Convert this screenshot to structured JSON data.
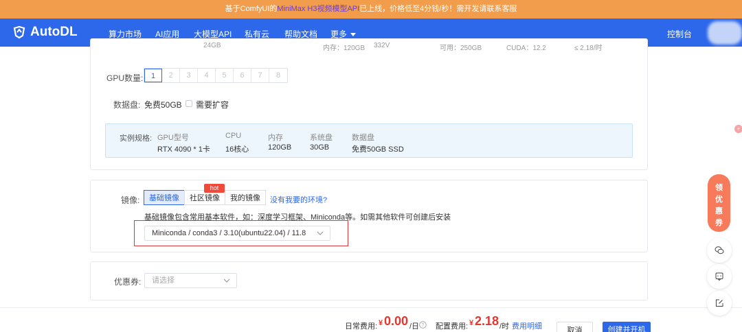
{
  "banner": {
    "part1": "基于ComfyUI的",
    "highlight": "MiniMax H3视频模型API",
    "part2": "已上线，价格低至4分钱/秒！需开发请联系客服"
  },
  "nav": {
    "logo": "AutoDL",
    "items": [
      "算力市场",
      "AI应用",
      "大模型API",
      "私有云",
      "帮助文档",
      "更多"
    ],
    "console": "控制台"
  },
  "cut_row": [
    "24GB",
    "内存：120GB",
    "332V",
    "可用：250GB",
    "CUDA：12.2",
    "≤ 2.18/时"
  ],
  "gpu_count": {
    "label": "GPU数量:",
    "options": [
      "1",
      "2",
      "3",
      "4",
      "5",
      "6",
      "7",
      "8"
    ],
    "selected": "1"
  },
  "data_disk": {
    "label": "数据盘:",
    "free": "免费50GB",
    "expand_label": "需要扩容",
    "expand_checked": false
  },
  "spec": {
    "label": "实例规格:",
    "headers": [
      "GPU型号",
      "CPU",
      "内存",
      "系统盘",
      "数据盘"
    ],
    "values": [
      "RTX 4090 * 1卡",
      "16核心",
      "120GB",
      "30GB",
      "免费50GB SSD"
    ]
  },
  "image": {
    "label": "镜像:",
    "tabs": [
      "基础镜像",
      "社区镜像",
      "我的镜像"
    ],
    "active_tab": "基础镜像",
    "hot_badge": "hot",
    "missing_link": "没有我要的环境?",
    "description": "基础镜像包含常用基本软件，如：深度学习框架、Miniconda等。如需其他软件可创建后安装",
    "selected": "Miniconda / conda3 / 3.10(ubuntu22.04) / 11.8"
  },
  "coupon": {
    "label": "优惠券:",
    "placeholder": "请选择"
  },
  "footer": {
    "daily_label": "日常费用:",
    "daily_currency": "¥",
    "daily_amount": "0.00",
    "daily_unit": "/日",
    "config_label": "配置费用:",
    "config_currency": "¥",
    "config_amount": "2.18",
    "config_unit": "/时",
    "fee_detail": "费用明细",
    "cancel": "取消",
    "create": "创建并开机"
  },
  "float": {
    "coupon_chars": [
      "领",
      "优",
      "惠",
      "券"
    ],
    "edge_badge": "+"
  },
  "icons": {
    "logo": "autodl-logo-icon",
    "more": "chevron-down-icon",
    "help": "question-circle-icon",
    "wechat": "wechat-icon",
    "message": "message-icon",
    "feedback": "edit-icon"
  },
  "colors": {
    "brand": "#2d67ea",
    "banner": "#f29d4b",
    "price": "#e3372f",
    "highlight_box": "#d9383a"
  }
}
